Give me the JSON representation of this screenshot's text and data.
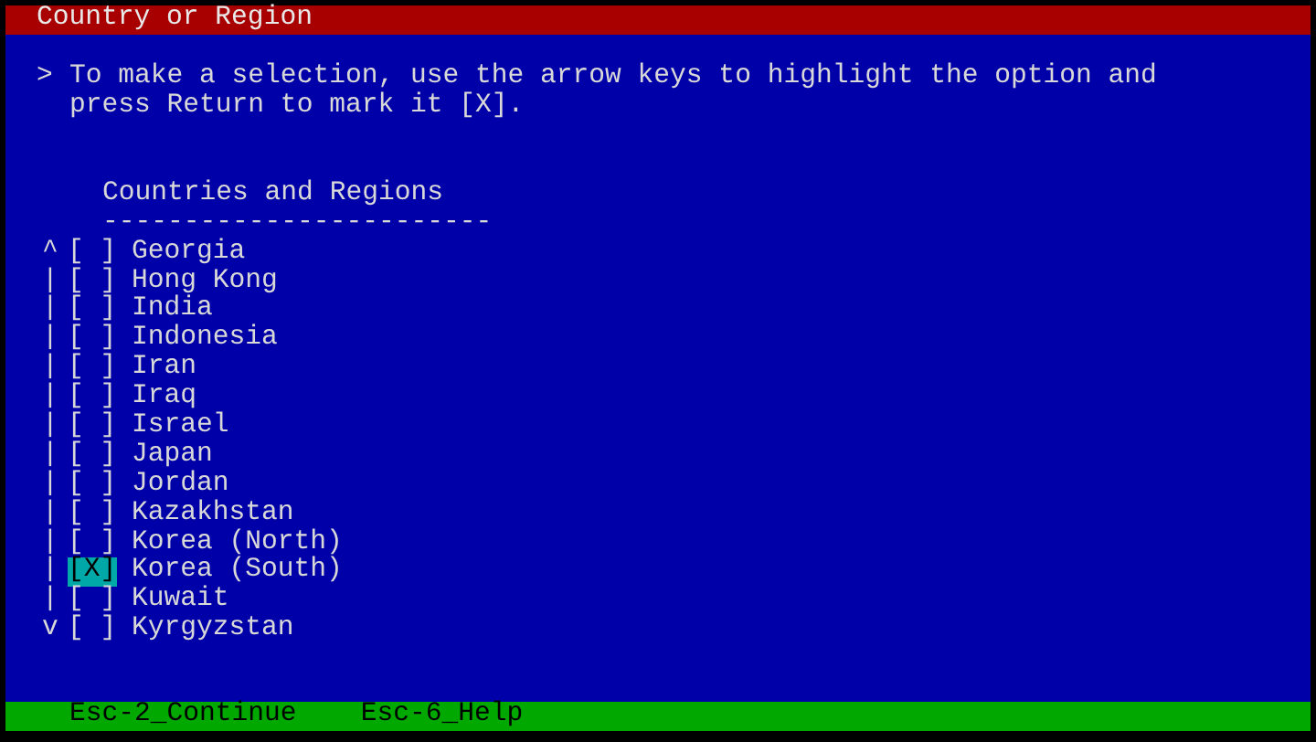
{
  "title_bar": {
    "title": "Country or Region"
  },
  "prompt": {
    "marker": ">",
    "lines": [
      "To make a selection, use the arrow keys to highlight the option and",
      "press Return to mark it [X]."
    ]
  },
  "list": {
    "heading": "Countries and Regions",
    "heading_rule": "------------------------",
    "items": [
      {
        "scroll": "^",
        "box": "[ ]",
        "label": "Georgia",
        "checked": false
      },
      {
        "scroll": "|",
        "box": "[ ]",
        "label": "Hong Kong",
        "checked": false
      },
      {
        "scroll": "|",
        "box": "[ ]",
        "label": "India",
        "checked": false
      },
      {
        "scroll": "|",
        "box": "[ ]",
        "label": "Indonesia",
        "checked": false
      },
      {
        "scroll": "|",
        "box": "[ ]",
        "label": "Iran",
        "checked": false
      },
      {
        "scroll": "|",
        "box": "[ ]",
        "label": "Iraq",
        "checked": false
      },
      {
        "scroll": "|",
        "box": "[ ]",
        "label": "Israel",
        "checked": false
      },
      {
        "scroll": "|",
        "box": "[ ]",
        "label": "Japan",
        "checked": false
      },
      {
        "scroll": "|",
        "box": "[ ]",
        "label": "Jordan",
        "checked": false
      },
      {
        "scroll": "|",
        "box": "[ ]",
        "label": "Kazakhstan",
        "checked": false
      },
      {
        "scroll": "|",
        "box": "[ ]",
        "label": "Korea (North)",
        "checked": false
      },
      {
        "scroll": "|",
        "box": "[X]",
        "label": "Korea (South)",
        "checked": true
      },
      {
        "scroll": "|",
        "box": "[ ]",
        "label": "Kuwait",
        "checked": false
      },
      {
        "scroll": "v",
        "box": "[ ]",
        "label": "Kyrgyzstan",
        "checked": false
      }
    ]
  },
  "function_keys": [
    "Esc-2_Continue",
    "Esc-6_Help"
  ]
}
